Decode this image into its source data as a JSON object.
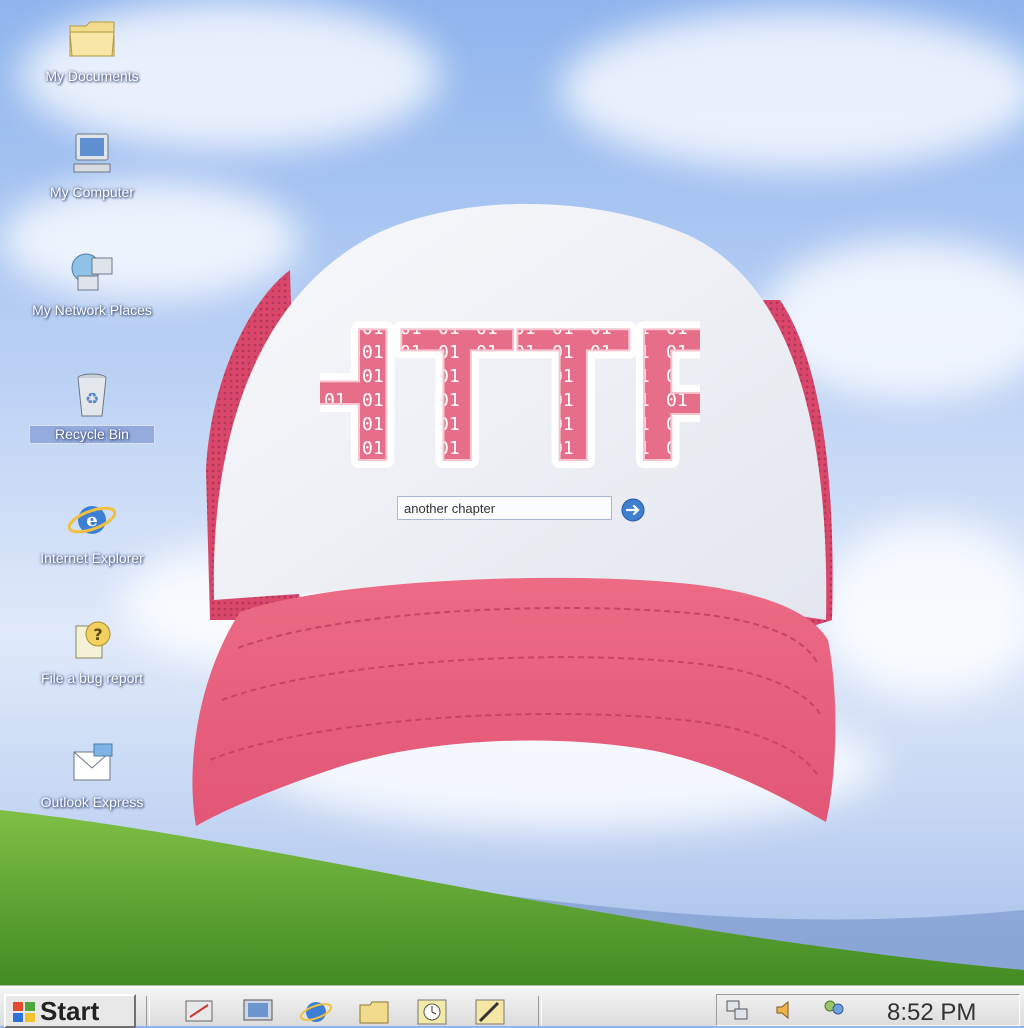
{
  "desktop": {
    "icons": [
      {
        "name": "my-documents",
        "label": "My Documents"
      },
      {
        "name": "my-computer",
        "label": "My Computer"
      },
      {
        "name": "my-network-places",
        "label": "My Network Places"
      },
      {
        "name": "recycle-bin",
        "label": "Recycle Bin"
      },
      {
        "name": "internet-explorer",
        "label": "Internet Explorer"
      },
      {
        "name": "file-a-bug-report",
        "label": "File a bug report"
      },
      {
        "name": "outlook-express",
        "label": "Outlook Express"
      }
    ]
  },
  "cap": {
    "title": "HTTP",
    "title_binary": "0 0 0 1 0 1 0 0 1 1 1 0",
    "search": {
      "value": "another chapter",
      "go_icon": "arrow-right-icon"
    },
    "colors": {
      "crown": "#f2f3f7",
      "visor": "#e8647e",
      "mesh": "#dc4e70",
      "text": "#e76e88"
    }
  },
  "taskbar": {
    "start_label": "Start",
    "quick_launch": [
      "show-desktop-icon",
      "monitor-icon",
      "internet-explorer-icon",
      "folder-icon",
      "clock-icon",
      "paint-icon"
    ],
    "tray_icons": [
      "network-icon",
      "speaker-icon",
      "messenger-icon"
    ],
    "clock": "8:52 PM"
  }
}
